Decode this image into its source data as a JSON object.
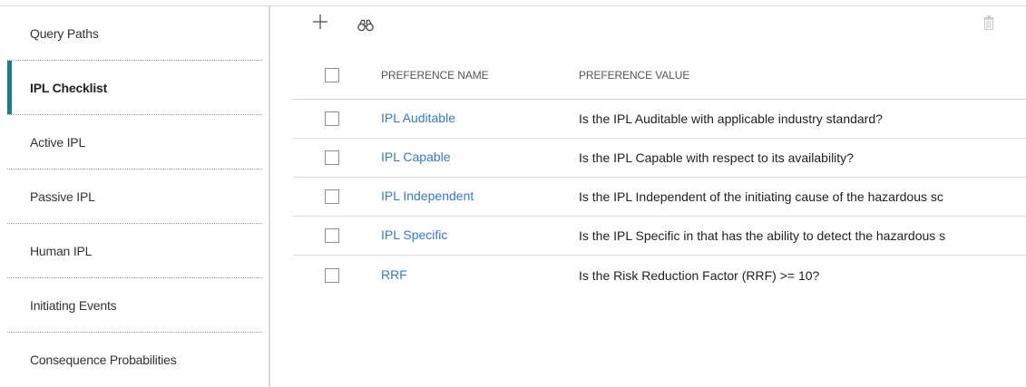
{
  "sidebar": {
    "items": [
      {
        "label": "Query Paths"
      },
      {
        "label": "IPL Checklist",
        "active": true
      },
      {
        "label": "Active IPL"
      },
      {
        "label": "Passive IPL"
      },
      {
        "label": "Human IPL"
      },
      {
        "label": "Initiating Events"
      },
      {
        "label": "Consequence Probabilities"
      }
    ],
    "active_accent_color": "#1e7c8f"
  },
  "toolbar": {
    "icons": [
      "plus-icon",
      "binoculars-icon",
      "trash-icon"
    ]
  },
  "table": {
    "columns": {
      "name": "PREFERENCE NAME",
      "value": "PREFERENCE VALUE"
    },
    "rows": [
      {
        "name": "IPL Auditable",
        "value": "Is the IPL Auditable with applicable industry standard?"
      },
      {
        "name": "IPL Capable",
        "value": "Is the IPL Capable with respect to its availability?"
      },
      {
        "name": "IPL Independent",
        "value": "Is the IPL Independent of the initiating cause of the hazardous sc"
      },
      {
        "name": "IPL Specific",
        "value": "Is the IPL Specific in that has the ability to detect the hazardous s"
      },
      {
        "name": "RRF",
        "value": "Is the Risk Reduction Factor (RRF) >= 10?"
      }
    ],
    "link_color": "#3a78c9"
  }
}
